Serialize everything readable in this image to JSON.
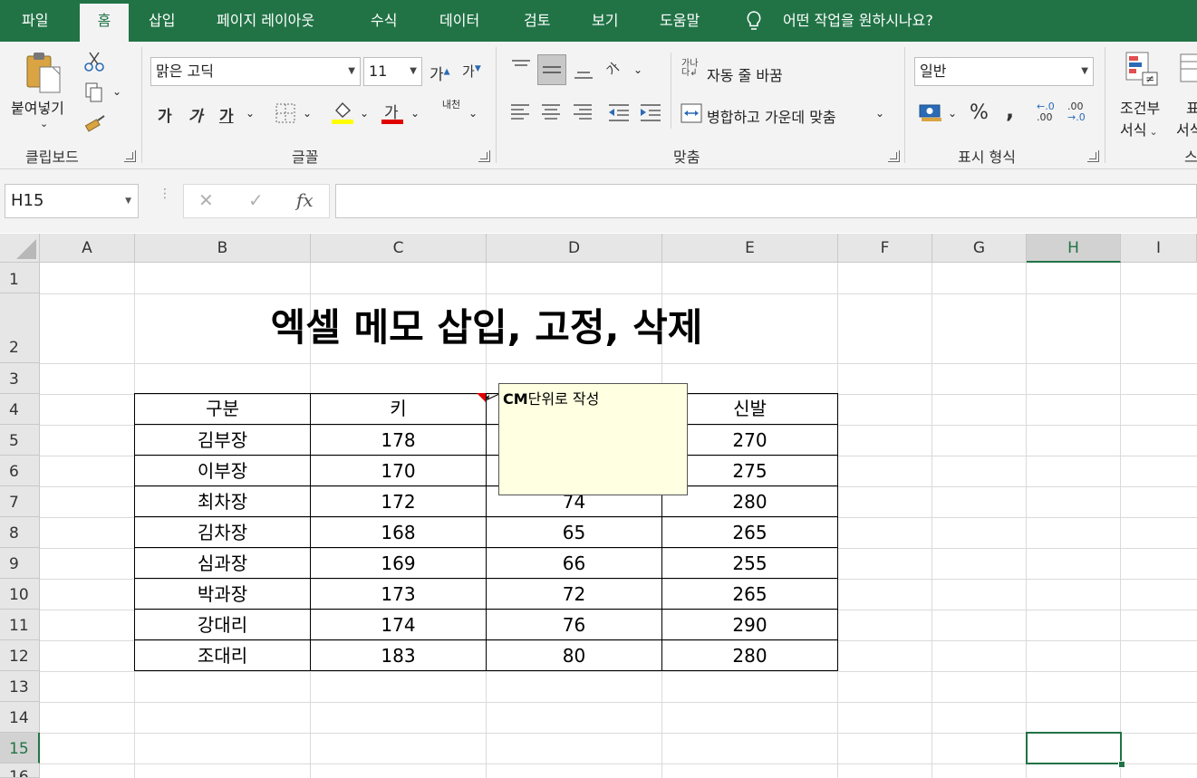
{
  "menu": {
    "tabs": [
      "파일",
      "홈",
      "삽입",
      "페이지 레이아웃",
      "수식",
      "데이터",
      "검토",
      "보기",
      "도움말"
    ],
    "active_tab": "홈",
    "tell_me": "어떤 작업을 원하시나요?"
  },
  "ribbon": {
    "clipboard": {
      "paste": "붙여넣기",
      "label": "클립보드"
    },
    "font": {
      "name": "맑은 고딕",
      "size": "11",
      "grow": "가",
      "shrink": "가",
      "bold": "가",
      "italic": "가",
      "underline": "가",
      "font_color": "가",
      "phonetic": "내천",
      "label": "글꼴"
    },
    "alignment": {
      "wrap": "자동 줄 바꿈",
      "merge": "병합하고 가운데 맞춤",
      "orientation": "가",
      "label": "맞춤"
    },
    "number": {
      "format": "일반",
      "percent": "%",
      "comma": ",",
      "inc_decimal": "←.0 .00",
      "dec_decimal": ".00 →.0",
      "label": "표시 형식"
    },
    "styles": {
      "conditional_line1": "조건부",
      "conditional_line2": "서식",
      "next1": "표",
      "next2": "서식",
      "next_label": "스"
    }
  },
  "formula_bar": {
    "name_box": "H15",
    "fx": "fx",
    "cancel": "✕",
    "enter": "✓",
    "formula": ""
  },
  "columns": [
    "A",
    "B",
    "C",
    "D",
    "E",
    "F",
    "G",
    "H",
    "I"
  ],
  "rows": [
    "1",
    "2",
    "3",
    "4",
    "5",
    "6",
    "7",
    "8",
    "9",
    "10",
    "11",
    "12",
    "13",
    "14",
    "15",
    "16"
  ],
  "selected": {
    "col": "H",
    "row": "15"
  },
  "sheet": {
    "title": "엑셀 메모 삽입, 고정, 삭제",
    "table": {
      "headers": [
        "구분",
        "키",
        "",
        "신발"
      ],
      "rows": [
        [
          "김부장",
          "178",
          "",
          "270"
        ],
        [
          "이부장",
          "170",
          "",
          "275"
        ],
        [
          "최차장",
          "172",
          "74",
          "280"
        ],
        [
          "김차장",
          "168",
          "65",
          "265"
        ],
        [
          "심과장",
          "169",
          "66",
          "255"
        ],
        [
          "박과장",
          "173",
          "72",
          "265"
        ],
        [
          "강대리",
          "174",
          "76",
          "290"
        ],
        [
          "조대리",
          "183",
          "80",
          "280"
        ]
      ]
    }
  },
  "comment": {
    "bold": "CM",
    "text": "단위로 작성"
  },
  "colors": {
    "accent": "#217346",
    "comment_bg": "#ffffe1",
    "comment_marker": "#e00000"
  }
}
